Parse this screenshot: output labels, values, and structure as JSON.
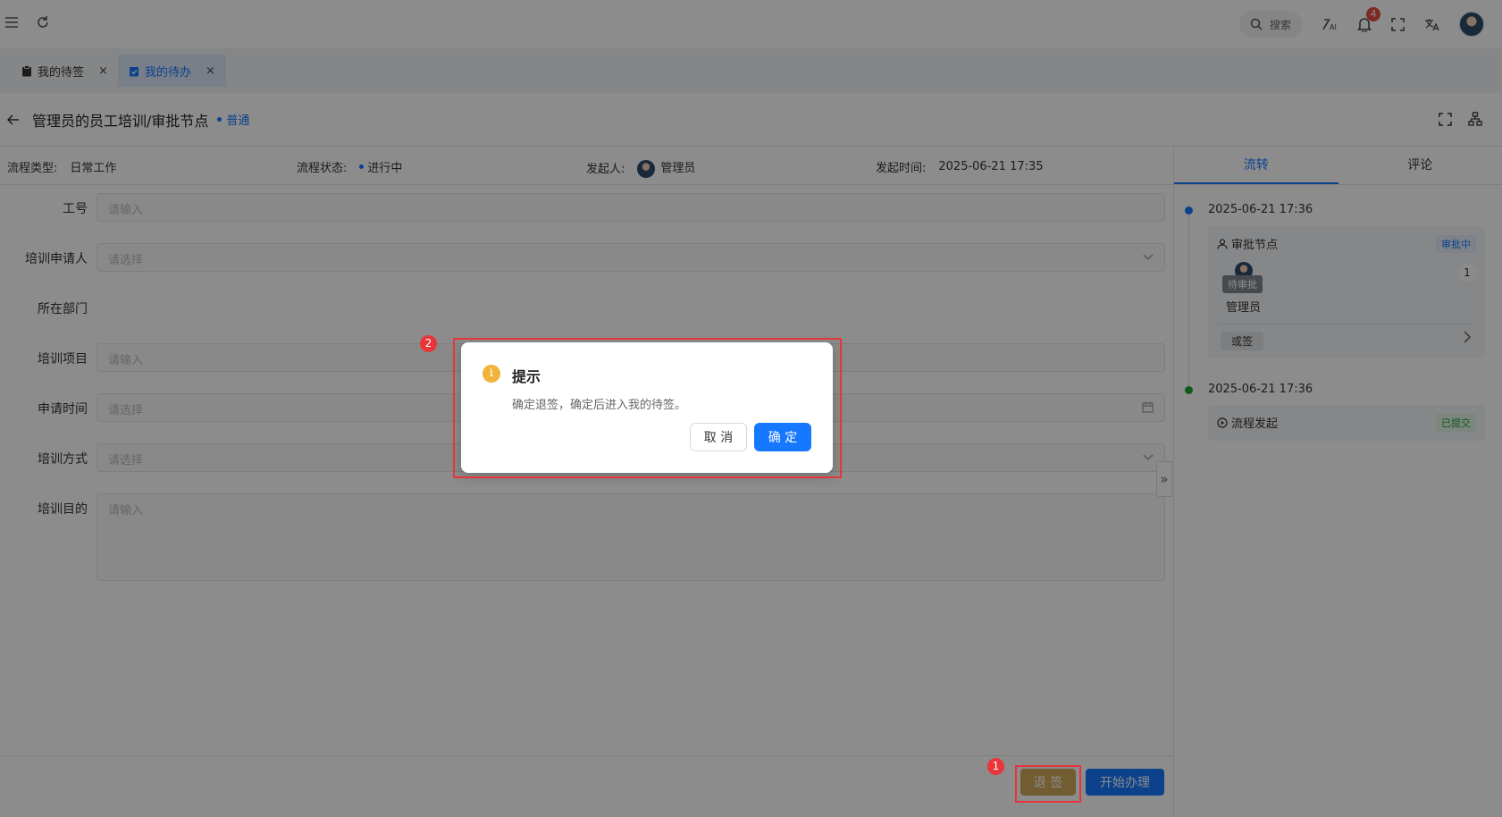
{
  "topbar": {
    "search_label": "搜索",
    "notification_count": "4"
  },
  "tabs": [
    {
      "label": "我的待签",
      "close": "×"
    },
    {
      "label": "我的待办",
      "close": "×"
    }
  ],
  "header": {
    "title": "管理员的员工培训/审批节点",
    "priority": "普通"
  },
  "meta": {
    "type_label": "流程类型:",
    "type_value": "日常工作",
    "status_label": "流程状态:",
    "status_value": "进行中",
    "initiator_label": "发起人:",
    "initiator_value": "管理员",
    "time_label": "发起时间:",
    "time_value": "2025-06-21 17:35"
  },
  "form": {
    "fields": [
      {
        "label": "工号",
        "placeholder": "请输入"
      },
      {
        "label": "培训申请人",
        "placeholder": "请选择"
      },
      {
        "label": "所在部门",
        "placeholder": ""
      },
      {
        "label": "培训项目",
        "placeholder": "请输入"
      },
      {
        "label": "申请时间",
        "placeholder": "请选择"
      },
      {
        "label": "培训方式",
        "placeholder": "请选择"
      },
      {
        "label": "培训目的",
        "placeholder": "请输入"
      }
    ]
  },
  "side": {
    "tabs": [
      "流转",
      "评论"
    ],
    "events": [
      {
        "time": "2025-06-21 17:36",
        "node": "审批节点",
        "status": "审批中",
        "pending_label": "待审批",
        "count": "1",
        "person": "管理员",
        "sign_type": "或签"
      },
      {
        "time": "2025-06-21 17:36",
        "node": "流程发起",
        "status": "已提交"
      }
    ]
  },
  "footer": {
    "retreat_label": "退 签",
    "start_label": "开始办理"
  },
  "modal": {
    "icon": "i",
    "title": "提示",
    "content": "确定退签，确定后进入我的待签。",
    "cancel_label": "取 消",
    "ok_label": "确 定"
  },
  "annotations": {
    "step1": "1",
    "step2": "2"
  },
  "colors": {
    "primary": "#1677ff",
    "retreat": "#cba04a",
    "warning_icon": "#f0b33b",
    "highlight": "#e8353a",
    "timeline_active": "#1677ff",
    "timeline_done": "#22a33a"
  }
}
